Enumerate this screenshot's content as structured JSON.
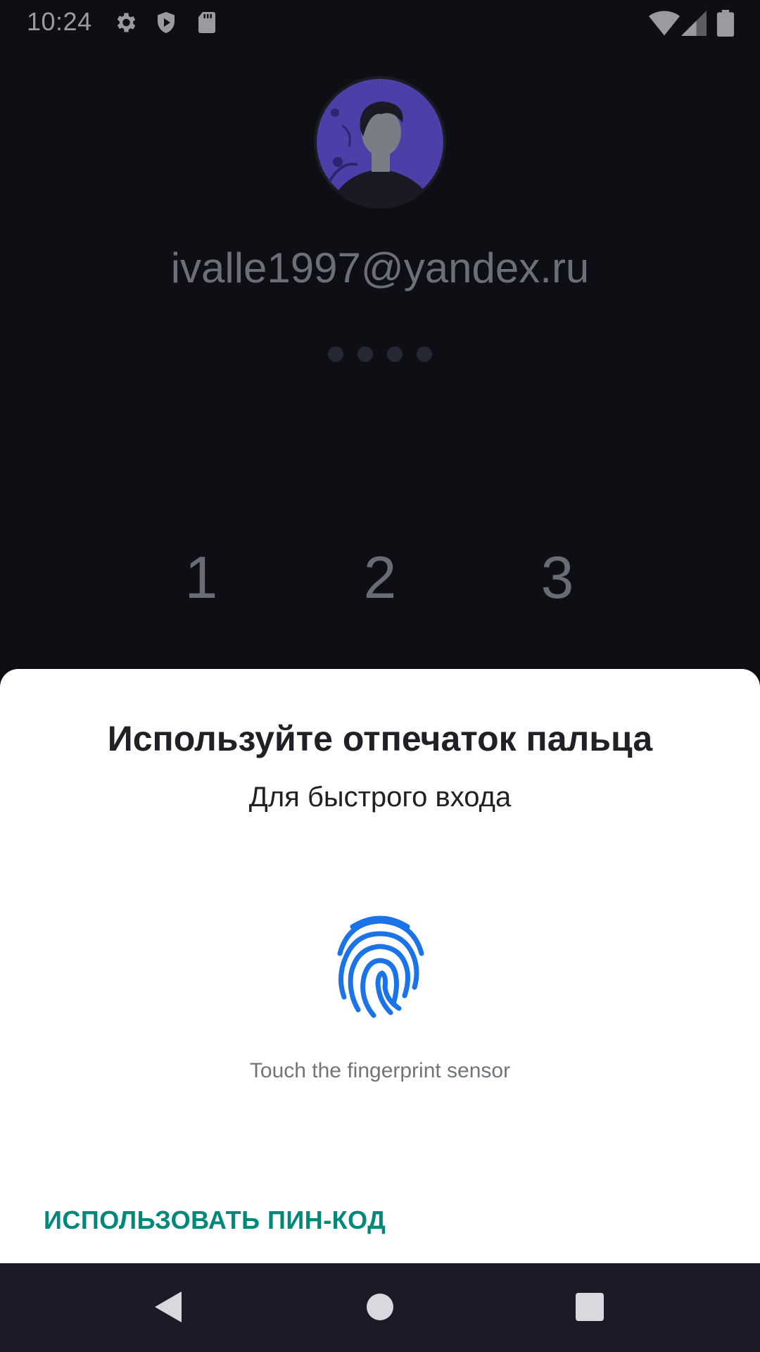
{
  "status_bar": {
    "time": "10:24",
    "icons": [
      "gear-icon",
      "shield-icon",
      "sd-card-icon",
      "wifi-icon",
      "signal-icon",
      "battery-icon"
    ]
  },
  "lock_screen": {
    "email": "ivalle1997@yandex.ru",
    "pin_dot_count": 4,
    "keypad_visible_keys": [
      "1",
      "2",
      "3"
    ]
  },
  "fingerprint_sheet": {
    "title": "Используйте отпечаток пальца",
    "subtitle": "Для быстрого входа",
    "hint": "Touch the fingerprint sensor",
    "use_pin_label": "ИСПОЛЬЗОВАТЬ ПИН-КОД",
    "icon": "fingerprint-icon"
  },
  "nav_bar": {
    "buttons": [
      "back-icon",
      "home-icon",
      "recents-icon"
    ]
  },
  "colors": {
    "background": "#0e0f15",
    "accent_teal": "#00897b",
    "fingerprint_blue": "#1a73e8",
    "avatar_purple": "#4c3fa8",
    "nav_bar": "#1a1b26"
  }
}
